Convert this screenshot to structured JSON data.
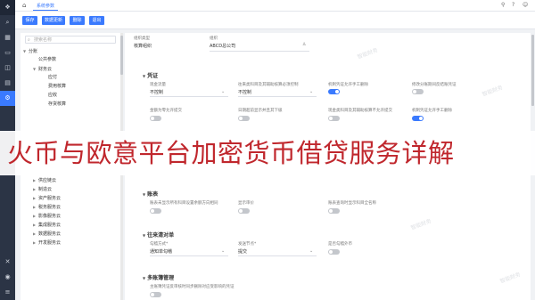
{
  "topbar": {
    "tab_label": "系统参数"
  },
  "toolbar": {
    "buttons": [
      "保存",
      "数据更新",
      "删除",
      "退出"
    ]
  },
  "tree": {
    "search_placeholder": "搜索名称",
    "nodes": [
      "分账",
      "公共参数",
      "财务云",
      "应付",
      "费用核算",
      "应收",
      "存货核算",
      "供应链云",
      "制造云",
      "资产服务云",
      "税务服务云",
      "影像服务云",
      "集成服务云",
      "数据服务云",
      "开发服务云"
    ]
  },
  "header": {
    "org_type_label": "组织类型",
    "org_type_value": "核算组织",
    "org_label": "组织",
    "org_value": "ABCD总公司"
  },
  "sections": {
    "voucher": {
      "title": "凭证",
      "fields": [
        {
          "label": "现金流量",
          "value": "不控制"
        },
        {
          "label": "往来类科目及其辅助核算必须控制",
          "value": "不控制"
        }
      ],
      "toggles": [
        "机制凭证允许手工删除",
        "修改分账期间反结账凭证",
        "金额为零允许提交",
        "日期超前显示并且其下级",
        "现金类科目及其辅助核算不允许提交",
        "机制凭证允许手工删除"
      ]
    },
    "ledger": {
      "title": "账表",
      "toggles": [
        "账表未显示所有科目设置余额方向相同",
        "显示审价",
        "账表查询时显示科目全名称"
      ]
    },
    "recon": {
      "title": "往来清对单",
      "fields": [
        {
          "label": "勾稽方式*",
          "value": "通知单勾稽"
        },
        {
          "label": "发送节点*",
          "value": "提交"
        }
      ],
      "toggle_label": "是否勾稽外币"
    },
    "multi_book": {
      "title": "多账簿管理",
      "hint": "主账簿凭证反审核时同步删除对应受影响的凭证"
    }
  },
  "banner": {
    "text": "火币与欧意平台加密货币借贷服务详解"
  },
  "watermark": {
    "text": "智能财务"
  },
  "colors": {
    "accent": "#3a7afe",
    "sidebar": "#2b3445",
    "banner_text": "#c0272d"
  }
}
